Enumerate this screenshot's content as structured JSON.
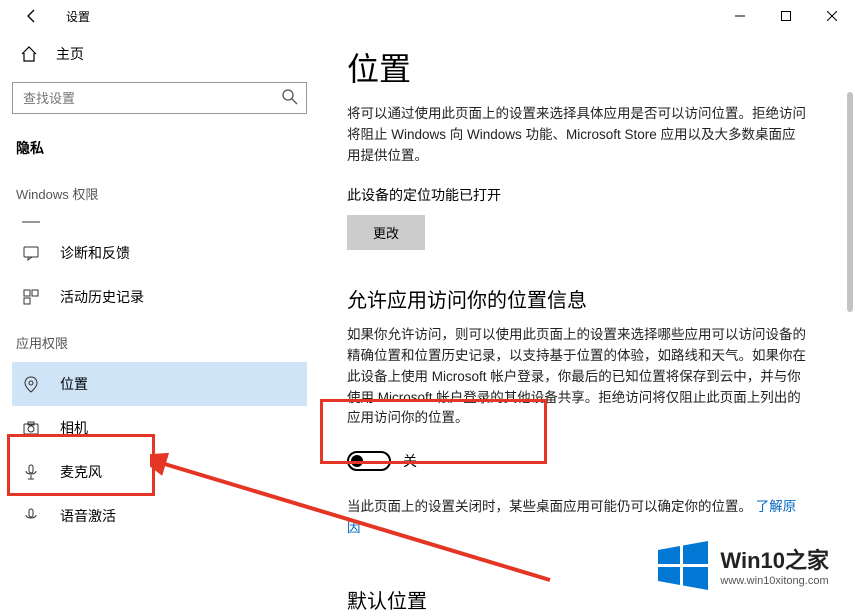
{
  "window": {
    "title": "设置"
  },
  "sidebar": {
    "home": "主页",
    "search_placeholder": "查找设置",
    "privacy_header": "隐私",
    "windows_perms_header": "Windows 权限",
    "app_perms_header": "应用权限",
    "items": [
      {
        "label": "诊断和反馈"
      },
      {
        "label": "活动历史记录"
      },
      {
        "label": "位置"
      },
      {
        "label": "相机"
      },
      {
        "label": "麦克风"
      },
      {
        "label": "语音激活"
      }
    ]
  },
  "content": {
    "page_title": "位置",
    "intro_text": "将可以通过使用此页面上的设置来选择具体应用是否可以访问位置。拒绝访问将阻止 Windows 向 Windows 功能、Microsoft Store 应用以及大多数桌面应用提供位置。",
    "status_line": "此设备的定位功能已打开",
    "change_btn": "更改",
    "allow_header": "允许应用访问你的位置信息",
    "allow_text": "如果你允许访问，则可以使用此页面上的设置来选择哪些应用可以访问设备的精确位置和位置历史记录，以支持基于位置的体验，如路线和天气。如果你在此设备上使用 Microsoft 帐户登录，你最后的已知位置将保存到云中，并与你使用 Microsoft 帐户登录的其他设备共享。拒绝访问将仅阻止此页面上列出的应用访问你的位置。",
    "toggle_label": "关",
    "off_desc": "当此页面上的设置关闭时，某些桌面应用可能仍可以确定你的位置。",
    "learn_link": "了解原因",
    "default_header": "默认位置"
  },
  "watermark": {
    "text": "Win10之家",
    "url": "www.win10xitong.com"
  }
}
